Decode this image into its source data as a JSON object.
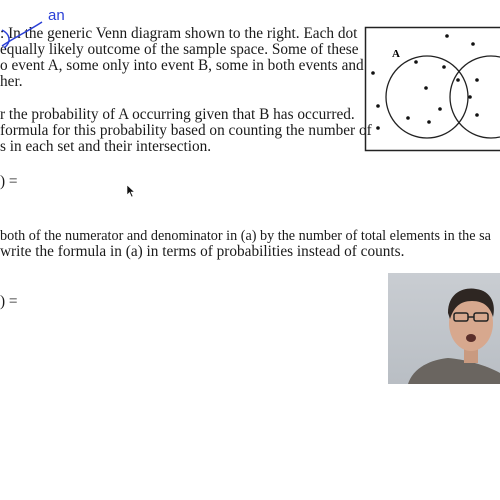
{
  "problem": {
    "intro_lines": [
      ": In the generic Venn diagram shown to the right. Each dot",
      "equally likely outcome of the sample space. Some of these",
      "o event A, some only into event B, some in both events and",
      "her."
    ],
    "part_a_lines": [
      "r the probability of A occurring given that B has occurred.",
      "formula for this probability based on counting the number of",
      "s in each set and their intersection."
    ],
    "part_a_answer": ") =",
    "part_b_lines": [
      "both of the numerator and denominator in (a) by the number of total elements in the sa",
      "write the formula in (a) in terms of probabilities instead of counts."
    ],
    "part_b_answer": ") ="
  },
  "annotation": {
    "handwritten": "an",
    "color": "#2a3fd6"
  },
  "venn": {
    "label_a": "A"
  },
  "webcam": {
    "present": true
  }
}
